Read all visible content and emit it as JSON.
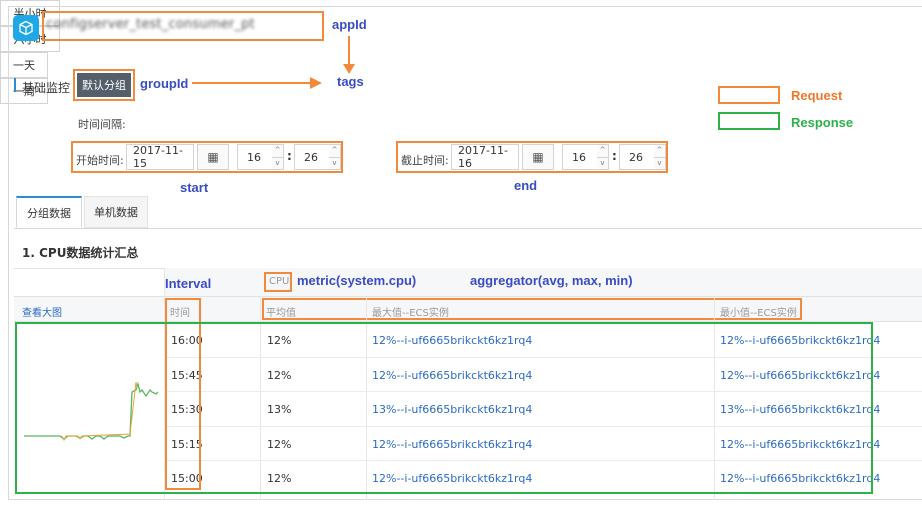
{
  "header": {
    "app_name": "configserver_test_consumer_pt"
  },
  "annotations": {
    "appid": "appId",
    "groupid": "groupId",
    "tags": "tags",
    "request": "Request",
    "response": "Response",
    "start": "start",
    "end": "end",
    "interval": "Interval",
    "metric": "metric(system.cpu)",
    "aggregator": "aggregator(avg, max, min)"
  },
  "section": {
    "title": "基础监控",
    "group_button": "默认分组"
  },
  "time_range": {
    "label": "时间间隔:",
    "options": [
      "半小时",
      "六小时",
      "一天",
      "一周"
    ]
  },
  "start": {
    "label": "开始时间:",
    "date": "2017-11-15",
    "hour": "16",
    "minute": "26"
  },
  "end": {
    "label": "截止时间:",
    "date": "2017-11-16",
    "hour": "16",
    "minute": "26"
  },
  "tabs": [
    "分组数据",
    "单机数据"
  ],
  "panel": {
    "title": "1. CPU数据统计汇总",
    "metric_tag": "CPU",
    "view_large": "查看大图",
    "columns": [
      "时间",
      "平均值",
      "最大值--ECS实例",
      "最小值--ECS实例"
    ],
    "rows": [
      {
        "time": "16:00",
        "avg": "12%",
        "max": "12%--i-uf6665brikckt6kz1rq4",
        "min": "12%--i-uf6665brikckt6kz1rq4"
      },
      {
        "time": "15:45",
        "avg": "12%",
        "max": "12%--i-uf6665brikckt6kz1rq4",
        "min": "12%--i-uf6665brikckt6kz1rq4"
      },
      {
        "time": "15:30",
        "avg": "13%",
        "max": "13%--i-uf6665brikckt6kz1rq4",
        "min": "13%--i-uf6665brikckt6kz1rq4"
      },
      {
        "time": "15:15",
        "avg": "12%",
        "max": "12%--i-uf6665brikckt6kz1rq4",
        "min": "12%--i-uf6665brikckt6kz1rq4"
      },
      {
        "time": "15:00",
        "avg": "12%",
        "max": "12%--i-uf6665brikckt6kz1rq4",
        "min": "12%--i-uf6665brikckt6kz1rq4"
      }
    ]
  },
  "icons": {
    "app": "cube-icon",
    "calendar": "calendar-icon"
  },
  "colors": {
    "request_outline": "#f38a3b",
    "response_outline": "#2bb34a",
    "label_blue": "#3a4cc4",
    "link": "#2b6bc4",
    "active_button": "#555e6b"
  }
}
